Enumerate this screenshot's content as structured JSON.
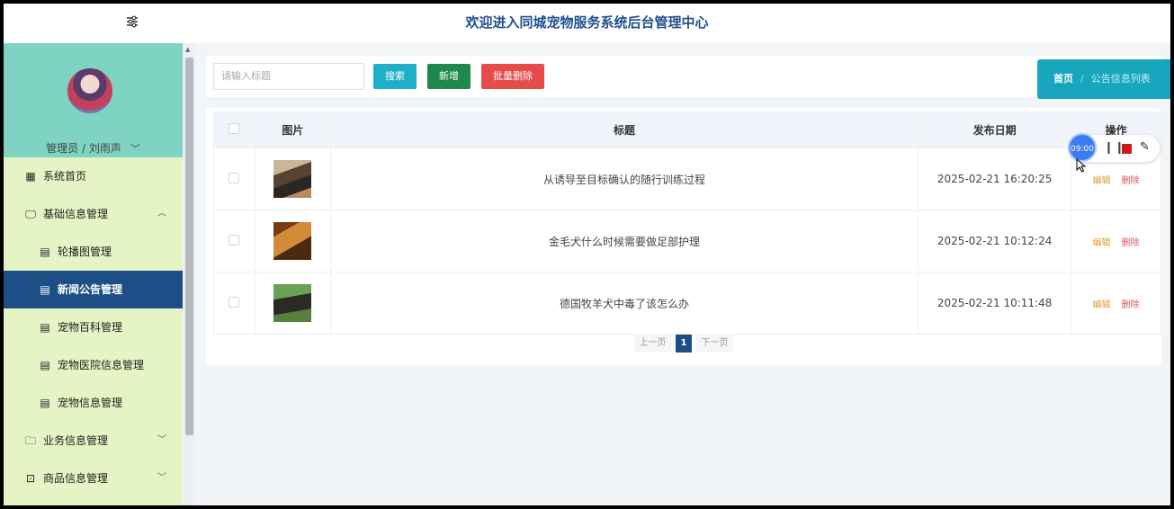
{
  "header": {
    "system_title": "欢迎进入同城宠物服务系统后台管理中心"
  },
  "sidebar": {
    "user_label": "管理员 / 刘雨声",
    "items": [
      {
        "label": "系统首页",
        "icon": "grid-icon"
      },
      {
        "label": "基础信息管理",
        "icon": "monitor-icon",
        "expanded": true
      },
      {
        "label": "轮播图管理",
        "icon": "doc-icon"
      },
      {
        "label": "新闻公告管理",
        "icon": "doc-icon",
        "active": true
      },
      {
        "label": "宠物百科管理",
        "icon": "doc-icon"
      },
      {
        "label": "宠物医院信息管理",
        "icon": "doc-icon"
      },
      {
        "label": "宠物信息管理",
        "icon": "doc-icon"
      },
      {
        "label": "业务信息管理",
        "icon": "folder-icon"
      },
      {
        "label": "商品信息管理",
        "icon": "box-icon"
      }
    ]
  },
  "toolbar": {
    "search_placeholder": "请输入标题",
    "search_label": "搜索",
    "add_label": "新增",
    "batch_delete_label": "批量删除"
  },
  "breadcrumb": {
    "home": "首页",
    "separator": "/",
    "current": "公告信息列表"
  },
  "table": {
    "headers": [
      "图片",
      "标题",
      "发布日期",
      "操作"
    ],
    "rows": [
      {
        "title": "从诱导至目标确认的随行训练过程",
        "date": "2025-02-21 16:20:25"
      },
      {
        "title": "金毛犬什么时候需要做足部护理",
        "date": "2025-02-21 10:12:24"
      },
      {
        "title": "德国牧羊犬中毒了该怎么办",
        "date": "2025-02-21 10:11:48"
      }
    ],
    "edit_label": "编辑",
    "delete_label": "删除"
  },
  "pager": {
    "prev": "上一页",
    "page": "1",
    "next": "下一页"
  },
  "recorder": {
    "time": "09:00"
  },
  "colors": {
    "accent": "#1d4f86",
    "sidebar_bg": "#e4f4c4",
    "profile_bg": "#7fd3c3",
    "search_btn": "#1fb0c9",
    "add_btn": "#21884b",
    "delete_btn": "#e64b4b"
  }
}
